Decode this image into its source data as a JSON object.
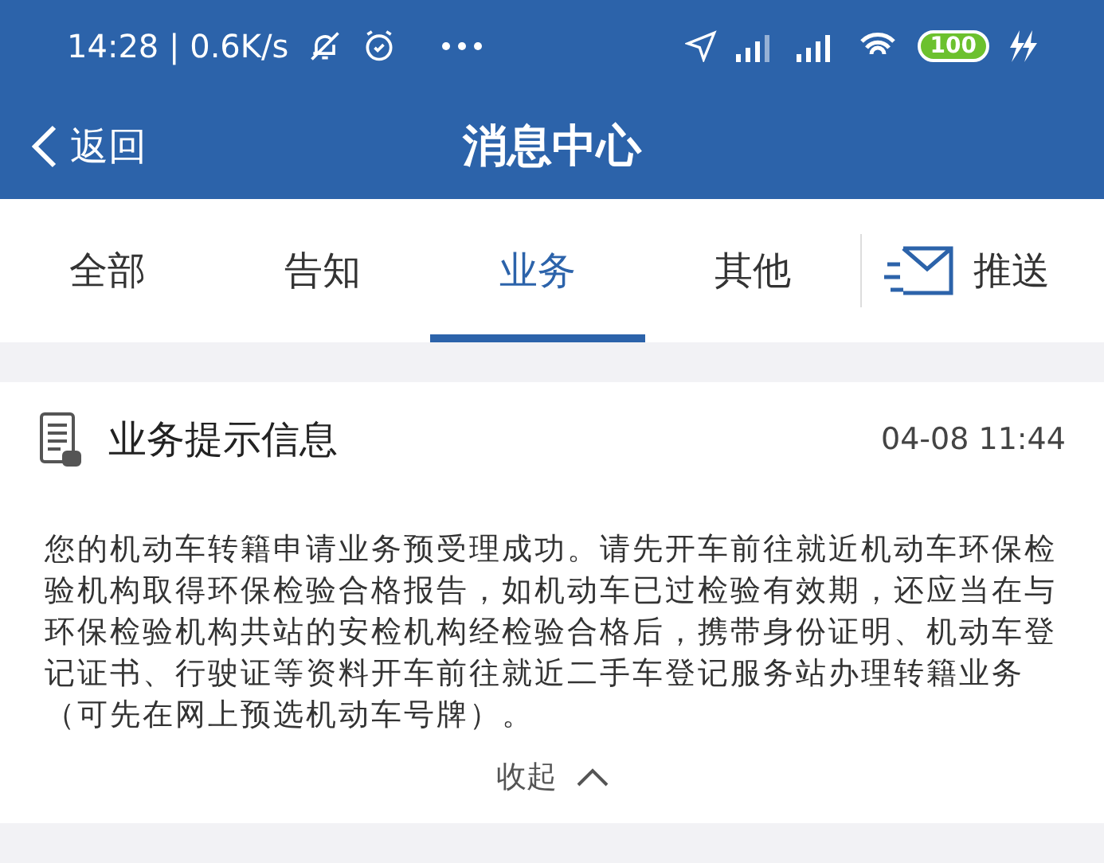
{
  "status_bar": {
    "time_speed": "14:28 | 0.6K/s",
    "battery": "100"
  },
  "header": {
    "back": "返回",
    "title": "消息中心"
  },
  "tabs": [
    {
      "label": "全部",
      "selected": false
    },
    {
      "label": "告知",
      "selected": false
    },
    {
      "label": "业务",
      "selected": true
    },
    {
      "label": "其他",
      "selected": false
    }
  ],
  "push_button": "推送",
  "message": {
    "title": "业务提示信息",
    "time": "04-08 11:44",
    "body": "您的机动车转籍申请业务预受理成功。请先开车前往就近机动车环保检验机构取得环保检验合格报告，如机动车已过检验有效期，还应当在与环保检验机构共站的安检机构经检验合格后，携带身份证明、机动车登记证书、行驶证等资料开车前往就近二手车登记服务站办理转籍业务（可先在网上预选机动车号牌）。",
    "collapse": "收起"
  }
}
